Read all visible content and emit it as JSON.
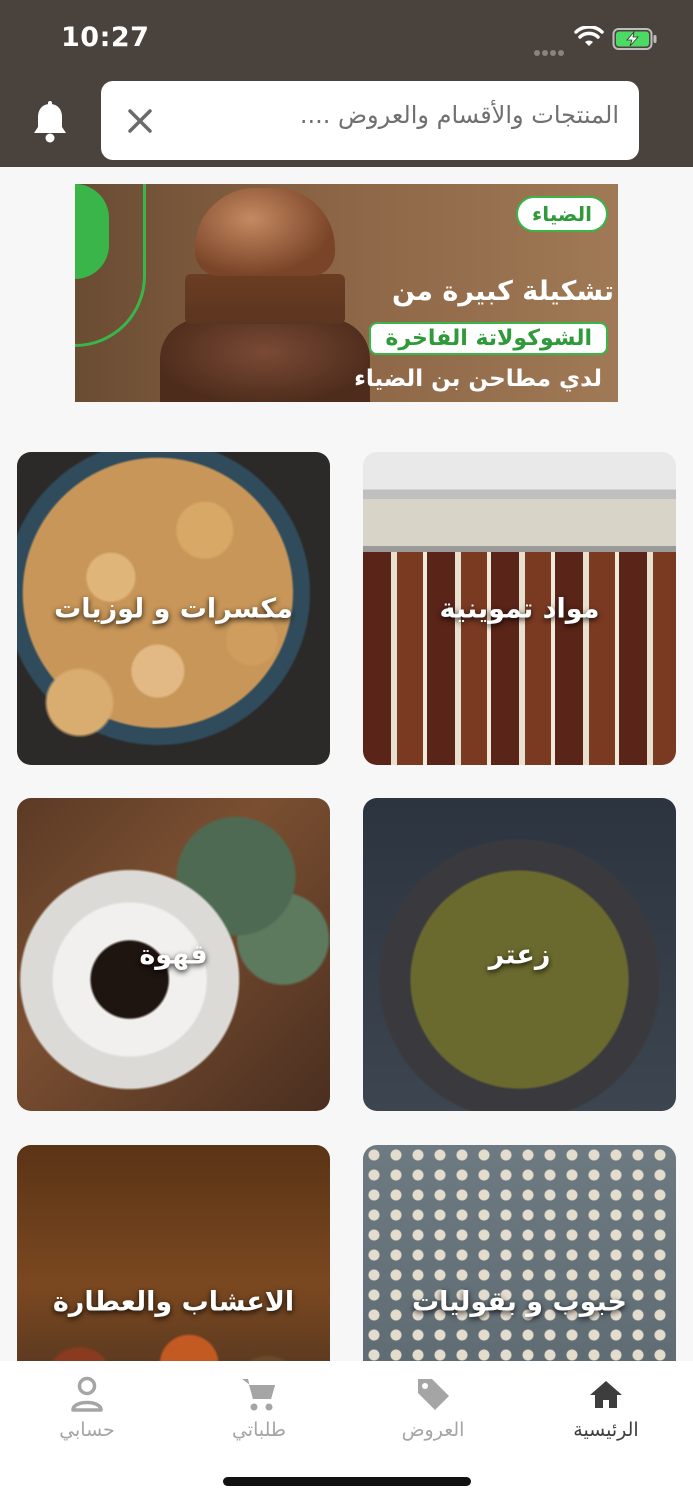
{
  "status_bar": {
    "time": "10:27"
  },
  "search": {
    "placeholder": "المنتجات والأقسام والعروض ...."
  },
  "banner": {
    "brand": "الضياء",
    "line1": "تشكيلة كبيرة من",
    "line2": "الشوكولاتة الفاخرة",
    "line3": "لدي مطاحن بن الضياء"
  },
  "categories": [
    {
      "label": "مكسرات و لوزيات"
    },
    {
      "label": "مواد تموينية"
    },
    {
      "label": "قهوة"
    },
    {
      "label": "زعتر"
    },
    {
      "label": "الاعشاب والعطارة"
    },
    {
      "label": "حبوب و بقوليات"
    }
  ],
  "nav": {
    "account": "حسابي",
    "orders": "طلباتي",
    "offers": "العروض",
    "home": "الرئيسية"
  },
  "colors": {
    "header": "#4a423c",
    "accent_green": "#39b54a",
    "nav_active": "#3d3d3d",
    "nav_inactive": "#a5a5a5"
  }
}
